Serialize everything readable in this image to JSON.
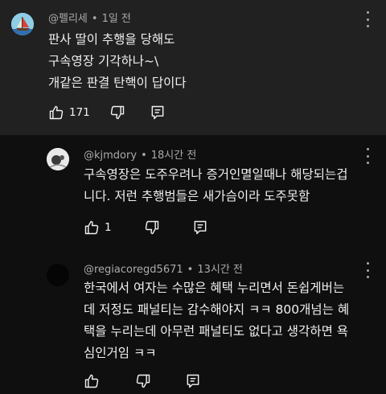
{
  "comments": [
    {
      "username": "@펠리세",
      "time": "1일 전",
      "lines": [
        "판사 딸이 추행을 당해도",
        "구속영장 기각하나~\\",
        "개같은 판결 탄핵이 답이다"
      ],
      "likes": "171"
    },
    {
      "username": "@kjmdory",
      "time": "18시간 전",
      "lines": [
        "구속영장은 도주우려나 증거인멸일때나 해당되는겁",
        "니다. 저런 추행범들은 새가슴이라 도주못함"
      ],
      "likes": "1"
    },
    {
      "username": "@regiacoregd5671",
      "time": "13시간 전",
      "lines": [
        "한국에서 여자는 수많은 혜택 누리면서 돈쉽게버는",
        "데 저정도 패널티는 감수해야지 ㅋㅋ 800개넘는 혜",
        "택을 누리는데 아무런 패널티도 없다고 생각하면 욕",
        "심인거임 ㅋㅋ"
      ],
      "likes": ""
    }
  ],
  "icons": {
    "like": "thumb-up-icon",
    "dislike": "thumb-down-icon",
    "reply": "reply-icon",
    "more": "more-vert-icon"
  },
  "colors": {
    "background": "#0f0f0f",
    "highlight_background": "#212121",
    "text": "#f1f1f1",
    "meta_text": "#aaaaaa"
  }
}
